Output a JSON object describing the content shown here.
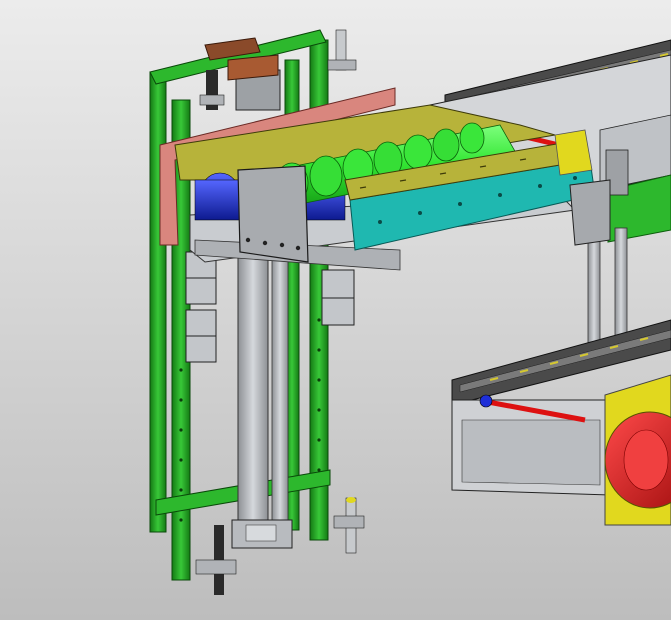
{
  "viewport": {
    "background_top": "#ececec",
    "background_bottom": "#bdbdbd"
  },
  "colors": {
    "frame_green": "#2db82d",
    "frame_green_dark": "#147a14",
    "roller_green": "#33e633",
    "roller_blue": "#1e2fd8",
    "side_cyan": "#1fb8b0",
    "side_yellow": "#b7b33a",
    "plate_pink": "#d9867e",
    "metal_grey": "#a6a9ad",
    "metal_light": "#cfd3d7",
    "rail_dark": "#3a3a3a",
    "motor_yellow": "#e1d81e",
    "motor_red": "#d81818",
    "bracket_brown": "#8a4a2a"
  },
  "icons": [
    "conveyor-assembly-icon"
  ]
}
